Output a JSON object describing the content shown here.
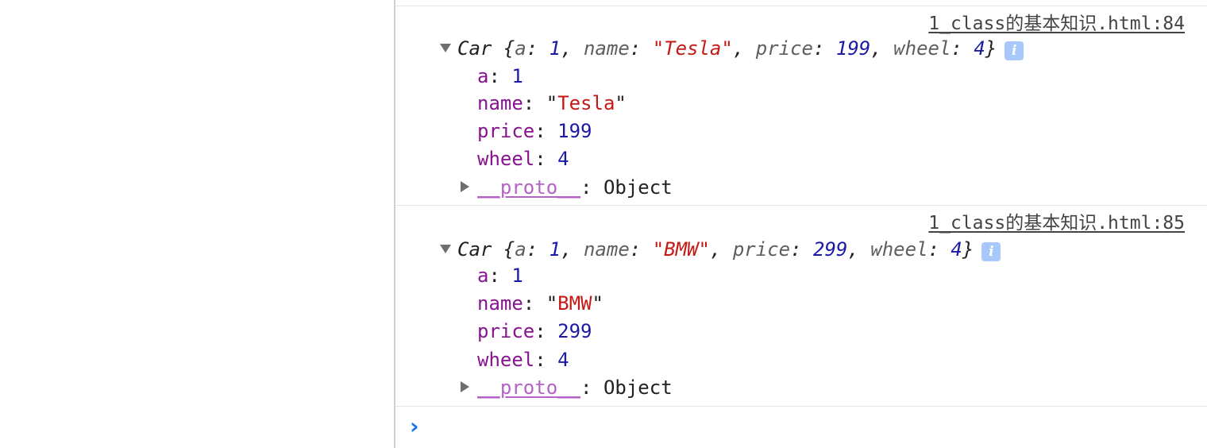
{
  "messages": [
    {
      "source": "1_class的基本知识.html:84",
      "summary": {
        "class_name": "Car",
        "a_val": "1",
        "name_val": "\"Tesla\"",
        "price_val": "199",
        "wheel_val": "4"
      },
      "props": [
        {
          "key": "a",
          "value": "1",
          "type": "number"
        },
        {
          "key": "name",
          "value": "\"Tesla\"",
          "type": "string"
        },
        {
          "key": "price",
          "value": "199",
          "type": "number"
        },
        {
          "key": "wheel",
          "value": "4",
          "type": "number"
        }
      ],
      "proto": {
        "key": "__proto__",
        "value": "Object"
      }
    },
    {
      "source": "1_class的基本知识.html:85",
      "summary": {
        "class_name": "Car",
        "a_val": "1",
        "name_val": "\"BMW\"",
        "price_val": "299",
        "wheel_val": "4"
      },
      "props": [
        {
          "key": "a",
          "value": "1",
          "type": "number"
        },
        {
          "key": "name",
          "value": "\"BMW\"",
          "type": "string"
        },
        {
          "key": "price",
          "value": "299",
          "type": "number"
        },
        {
          "key": "wheel",
          "value": "4",
          "type": "number"
        }
      ],
      "proto": {
        "key": "__proto__",
        "value": "Object"
      }
    }
  ],
  "labels": {
    "a": "a",
    "name": "name",
    "price": "price",
    "wheel": "wheel",
    "info": "i"
  },
  "prompt": {
    "caret": "›",
    "value": ""
  },
  "colors": {
    "key": "#881391",
    "number": "#1a1aa6",
    "string": "#c41a16",
    "proto": "#b562c6",
    "prompt": "#1a73e8",
    "info_badge": "#a8c7fa"
  }
}
